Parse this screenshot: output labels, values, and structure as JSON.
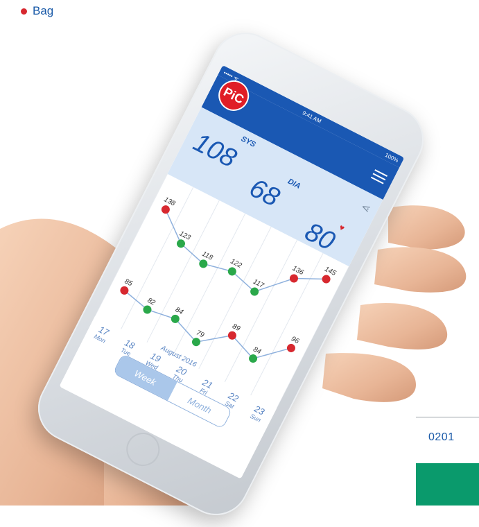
{
  "legend": {
    "bullet_label": "Bag"
  },
  "footer": {
    "code": "0201"
  },
  "colors": {
    "accent_blue": "#1a58b3",
    "accent_red": "#d7282f",
    "green": "#0a9a6c",
    "light_blue": "#d7e6f7"
  },
  "phone": {
    "status": {
      "signal": "••••• ᯤ",
      "time": "9:41 AM",
      "battery": "100%"
    },
    "logo_text": "PiC",
    "reading": {
      "sys_label": "SYS",
      "sys_value": "108",
      "dia_label": "DIA",
      "dia_value": "68",
      "pulse_value": "80"
    },
    "chart": {
      "sys_values": [
        "138",
        "123",
        "118",
        "122",
        "117",
        "136",
        "145"
      ],
      "dia_values": [
        "85",
        "82",
        "84",
        "79",
        "89",
        "84",
        "96"
      ],
      "sys_colors": [
        "red",
        "green",
        "green",
        "green",
        "green",
        "red",
        "red"
      ],
      "dia_colors": [
        "red",
        "green",
        "green",
        "green",
        "red",
        "green",
        "red"
      ]
    },
    "days": [
      {
        "num": "17",
        "name": "Mon"
      },
      {
        "num": "18",
        "name": "Tue"
      },
      {
        "num": "19",
        "name": "Wed"
      },
      {
        "num": "20",
        "name": "Thu"
      },
      {
        "num": "21",
        "name": "Fri"
      },
      {
        "num": "22",
        "name": "Sat"
      },
      {
        "num": "23",
        "name": "Sun"
      }
    ],
    "month_label": "August 2016",
    "toggle": {
      "week": "Week",
      "month": "Month"
    }
  }
}
